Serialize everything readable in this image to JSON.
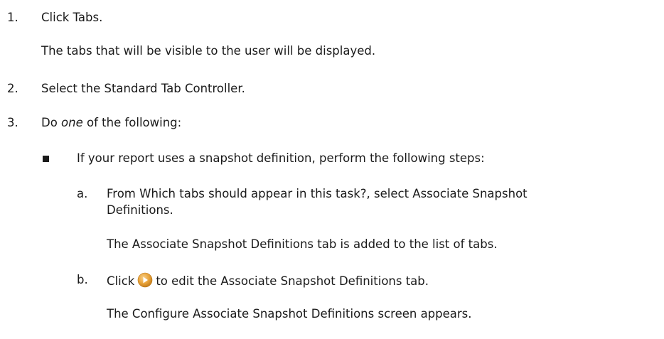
{
  "steps": [
    {
      "number": "1.",
      "text": "Click Tabs.",
      "note": "The tabs that will be visible to the user will be displayed."
    },
    {
      "number": "2.",
      "text": "Select the Standard Tab Controller."
    },
    {
      "number": "3.",
      "text_pre": "Do ",
      "text_em": "one",
      "text_post": " of the following:",
      "bullet": {
        "text": "If your report uses a snapshot definition, perform the following steps:",
        "substeps": [
          {
            "letter": "a.",
            "line1": "From Which tabs should appear in this task?, select Associate Snapshot",
            "line2": "Definitions.",
            "note": "The Associate Snapshot Definitions tab is added to the list of tabs."
          },
          {
            "letter": "b.",
            "pre": "Click",
            "icon": "play-arrow-icon",
            "post": "to edit the Associate Snapshot Definitions tab.",
            "note": "The Configure Associate Snapshot Definitions screen appears."
          }
        ]
      }
    }
  ],
  "colors": {
    "text": "#1a1a1a",
    "icon_orange": "#e8a33a",
    "icon_arrow": "#ffffff"
  }
}
